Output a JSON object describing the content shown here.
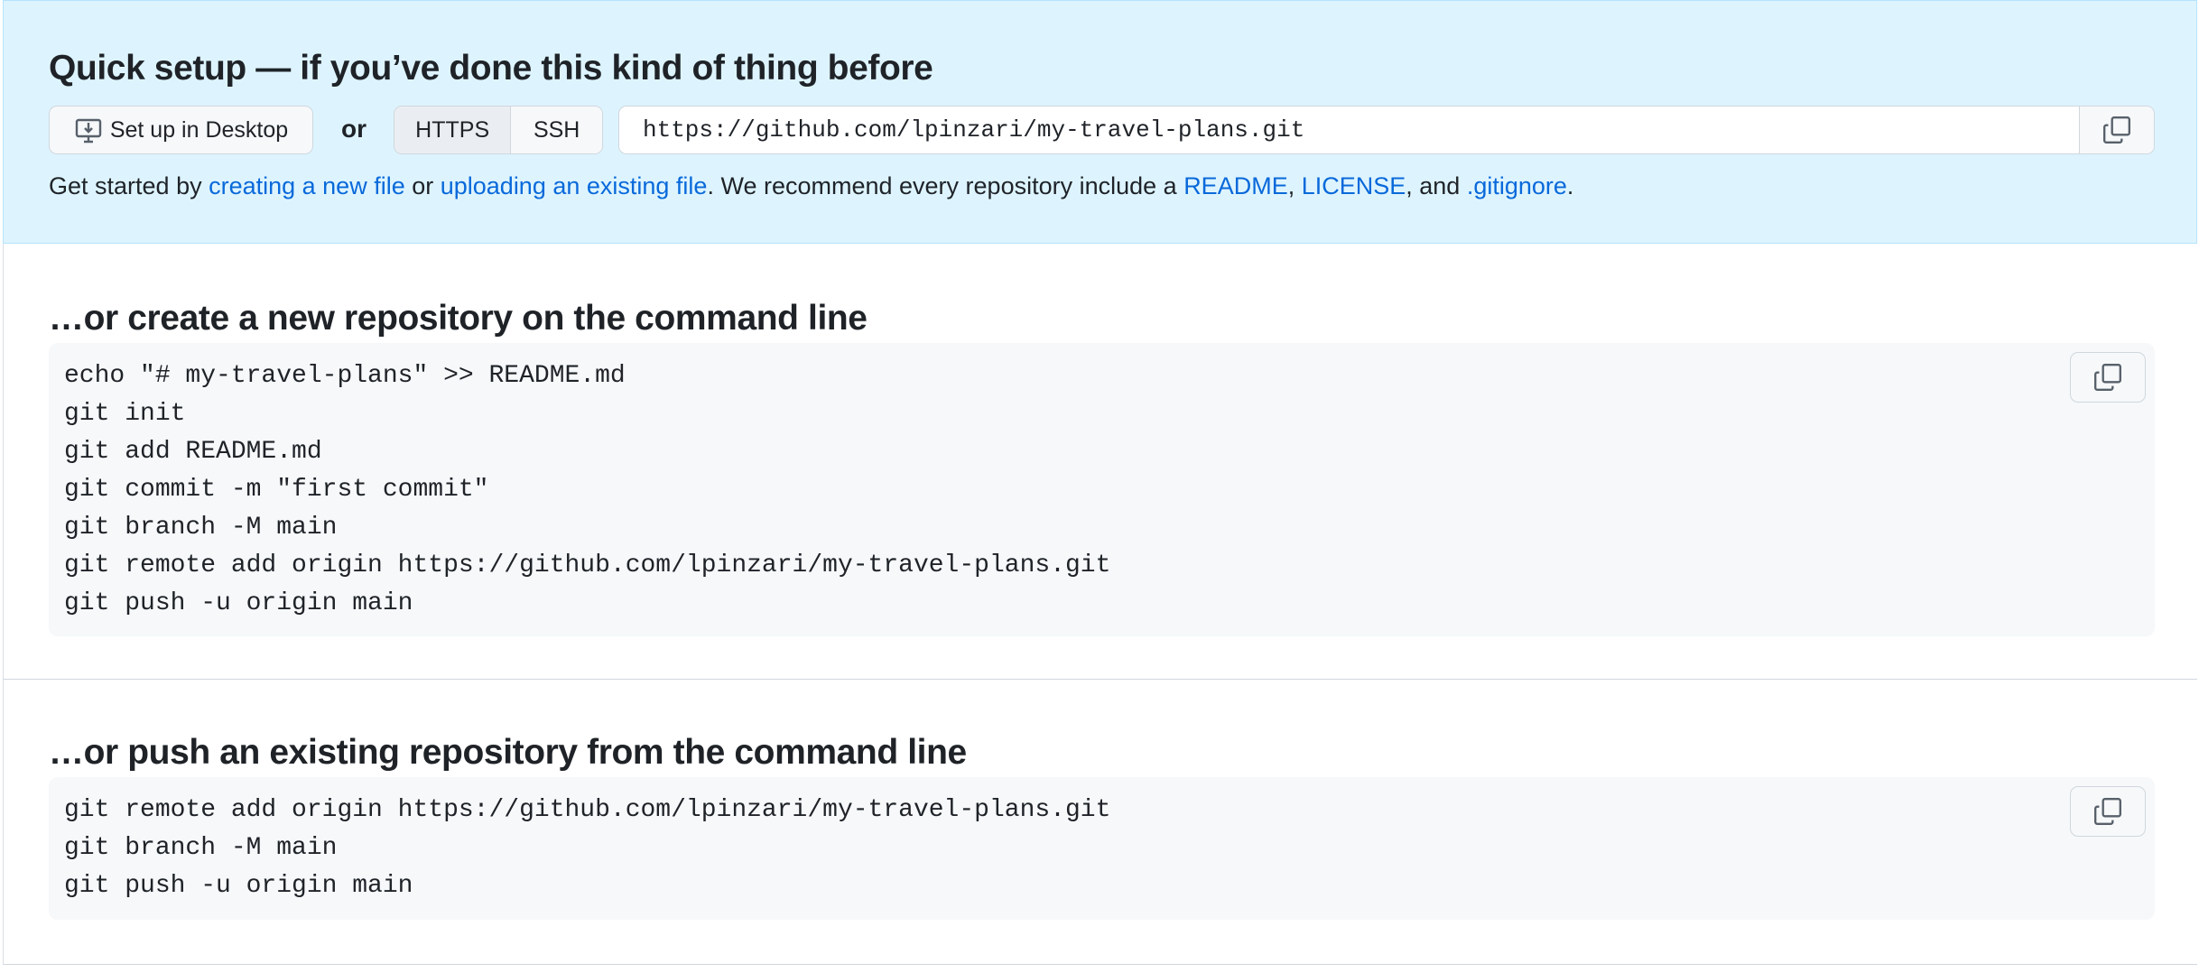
{
  "quick_setup": {
    "title": "Quick setup — if you’ve done this kind of thing before",
    "desktop_button": "Set up in Desktop",
    "or_label": "or",
    "protocols": [
      "HTTPS",
      "SSH"
    ],
    "selected_protocol": "HTTPS",
    "clone_url": "https://github.com/lpinzari/my-travel-plans.git",
    "hint": {
      "prefix": "Get started by ",
      "link1": "creating a new file",
      "or": " or ",
      "link2": "uploading an existing file",
      "middle": ". We recommend every repository include a ",
      "link3": "README",
      "comma1": ", ",
      "link4": "LICENSE",
      "comma2": ", and ",
      "link5": ".gitignore",
      "end": "."
    }
  },
  "new_repo": {
    "title": "…or create a new repository on the command line",
    "code": "echo \"# my-travel-plans\" >> README.md\ngit init\ngit add README.md\ngit commit -m \"first commit\"\ngit branch -M main\ngit remote add origin https://github.com/lpinzari/my-travel-plans.git\ngit push -u origin main"
  },
  "existing_repo": {
    "title": "…or push an existing repository from the command line",
    "code": "git remote add origin https://github.com/lpinzari/my-travel-plans.git\ngit branch -M main\ngit push -u origin main"
  },
  "icons": {
    "desktop": "desktop-download-icon",
    "copy": "copy-icon"
  },
  "colors": {
    "quick_bg": "#ddf4ff",
    "link": "#0969da",
    "code_bg": "#f6f8fa"
  }
}
